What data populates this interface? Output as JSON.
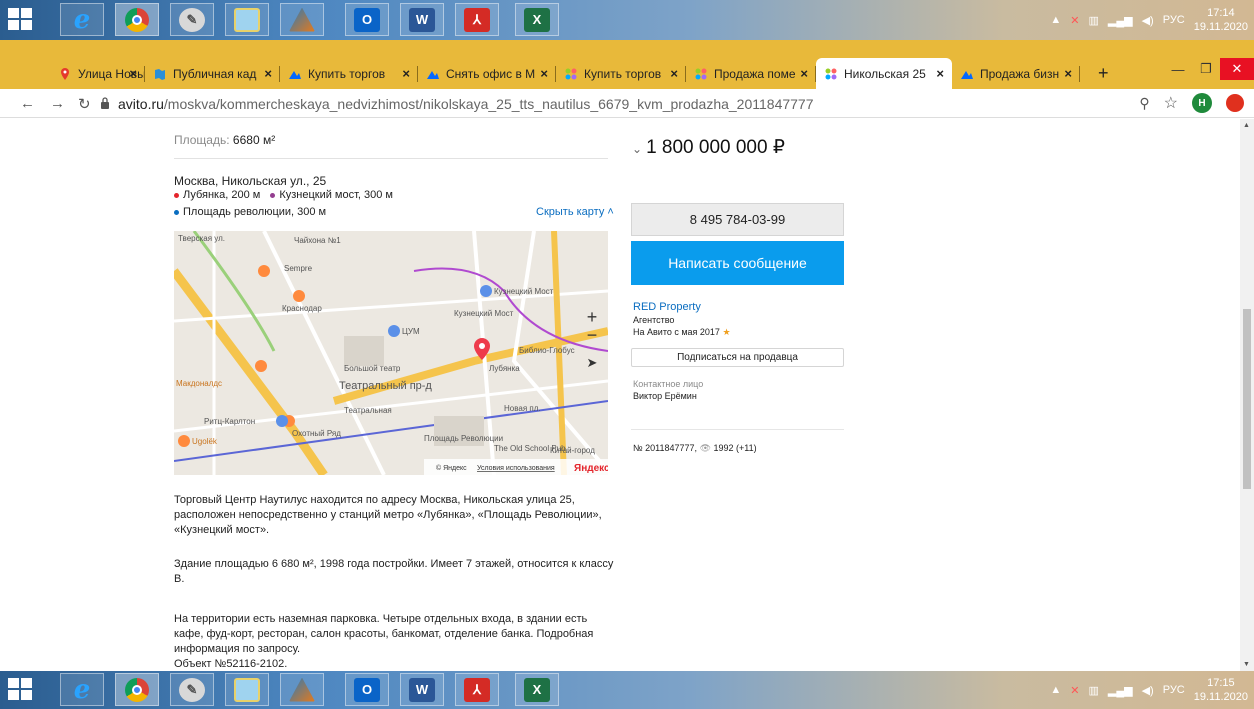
{
  "taskbar_top": {
    "apps": [
      "windows-start",
      "internet-explorer",
      "chrome",
      "paint",
      "notepad",
      "matlab",
      "outlook",
      "word",
      "acrobat",
      "excel"
    ],
    "tray": {
      "lang": "РУС",
      "time": "17:14",
      "date": "19.11.2020"
    }
  },
  "taskbar_bottom": {
    "tray": {
      "lang": "РУС",
      "time": "17:15",
      "date": "19.11.2020"
    }
  },
  "browser": {
    "tabs": [
      {
        "label": "Улица Новый А"
      },
      {
        "label": "Публичная кад"
      },
      {
        "label": "Купить торгов"
      },
      {
        "label": "Снять офис в М"
      },
      {
        "label": "Купить торгов"
      },
      {
        "label": "Продажа поме"
      },
      {
        "label": "Никольская 25"
      },
      {
        "label": "Продажа бизн"
      }
    ],
    "new_tab": "+",
    "url_domain": "avito.ru",
    "url_path": "/moskva/kommercheskaya_nedvizhimost/nikolskaya_25_tts_nautilus_6679_kvm_prodazha_2011847777",
    "profile_initial": "Н"
  },
  "listing": {
    "area_label": "Площадь:",
    "area_value": "6680 м²",
    "address": "Москва, Никольская ул., 25",
    "metro": [
      {
        "name": "Лубянка, 200 м",
        "color": "#e4252c"
      },
      {
        "name": "Кузнецкий мост, 300 м",
        "color": "#943e90"
      },
      {
        "name": "Площадь революции, 300 м",
        "color": "#0a6dc0"
      }
    ],
    "hide_map": "Скрыть карту",
    "map": {
      "labels": [
        "Тверская ул.",
        "Чайхона №1",
        "Sempre",
        "Краснодар",
        "ЦУМ",
        "Кузнецкий Мост",
        "Кузнецкий Мост",
        "Большой театр",
        "Театральный пр-д",
        "Лубянка",
        "Библио-Глобус",
        "Макдоналдс",
        "Ритц-Карлтон",
        "Театральная",
        "Охотный Ряд",
        "Площадь Революции",
        "The Old School Pub",
        "Китай-город",
        "Ugolёk",
        "Новая пл."
      ],
      "copyright": "© Яндекс",
      "terms": "Условия использования",
      "brand": "Яндекс"
    },
    "description": [
      "Торговый Центр Наутилус находится по адресу Москва, Никольская улица 25, расположен непосредственно у станций метро «Лубянка», «Площадь Революции», «Кузнецкий мост».",
      "Здание площадью 6 680 м², 1998 года постройки. Имеет 7 этажей, относится к классу В.",
      "На территории есть наземная парковка. Четыре отдельных входа, в здании есть кафе, фуд-корт, ресторан, салон красоты, банкомат, отделение банка. Подробная информация по запросу.",
      "Объект №52116-2102."
    ],
    "price": "1 800 000 000 ₽",
    "phone": "8 495 784-03-99",
    "message_button": "Написать сообщение",
    "seller_name": "RED Property",
    "seller_type": "Агентство",
    "seller_since": "На Авито с мая 2017",
    "subscribe": "Подписаться на продавца",
    "contact_label": "Контактное лицо",
    "contact_name": "Виктор Ерёмин",
    "listing_number": "№ 2011847777,",
    "views": "1992 (+11)"
  }
}
